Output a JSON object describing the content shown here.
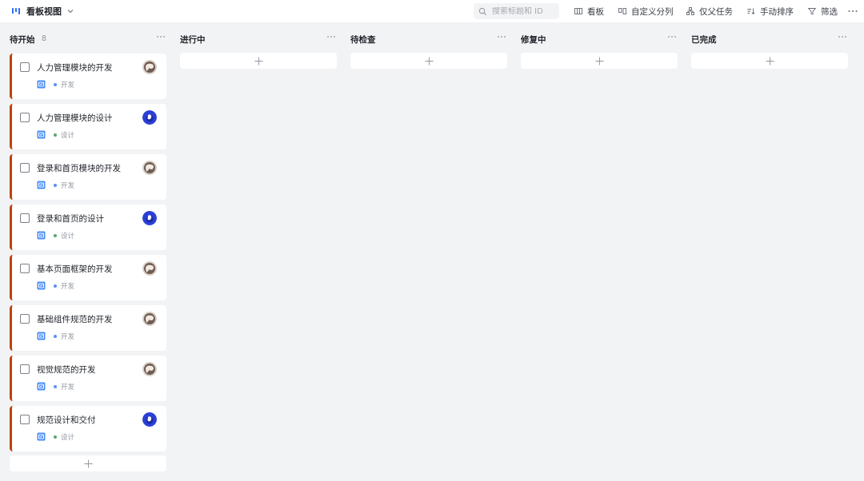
{
  "header": {
    "view_title": "看板视图",
    "view_icon": "kanban-view-icon",
    "search_placeholder": "搜索标题和 ID",
    "toolbar": [
      {
        "label": "看板",
        "icon": "board-layout-icon"
      },
      {
        "label": "自定义分列",
        "icon": "custom-columns-icon"
      },
      {
        "label": "仅父任务",
        "icon": "parent-task-icon"
      },
      {
        "label": "手动排序",
        "icon": "sort-icon"
      },
      {
        "label": "筛选",
        "icon": "filter-icon"
      }
    ],
    "more_label": "···"
  },
  "colors": {
    "accent": "#3370ff",
    "card_border": "#c2410c",
    "tag_dev": "#5b8ff9",
    "tag_design": "#5aa86f",
    "background": "#f2f3f5"
  },
  "columns": [
    {
      "title": "待开始",
      "count": "8",
      "cards": [
        {
          "title": "人力管理模块的开发",
          "tag": "开发",
          "avatar": "avatar-a"
        },
        {
          "title": "人力管理模块的设计",
          "tag": "设计",
          "avatar": "avatar-b"
        },
        {
          "title": "登录和首页模块的开发",
          "tag": "开发",
          "avatar": "avatar-a"
        },
        {
          "title": "登录和首页的设计",
          "tag": "设计",
          "avatar": "avatar-b"
        },
        {
          "title": "基本页面框架的开发",
          "tag": "开发",
          "avatar": "avatar-a"
        },
        {
          "title": "基础组件规范的开发",
          "tag": "开发",
          "avatar": "avatar-a"
        },
        {
          "title": "视觉规范的开发",
          "tag": "开发",
          "avatar": "avatar-a"
        },
        {
          "title": "规范设计和交付",
          "tag": "设计",
          "avatar": "avatar-b"
        }
      ]
    },
    {
      "title": "进行中",
      "count": "",
      "cards": []
    },
    {
      "title": "待检查",
      "count": "",
      "cards": []
    },
    {
      "title": "修复中",
      "count": "",
      "cards": []
    },
    {
      "title": "已完成",
      "count": "",
      "cards": []
    }
  ]
}
